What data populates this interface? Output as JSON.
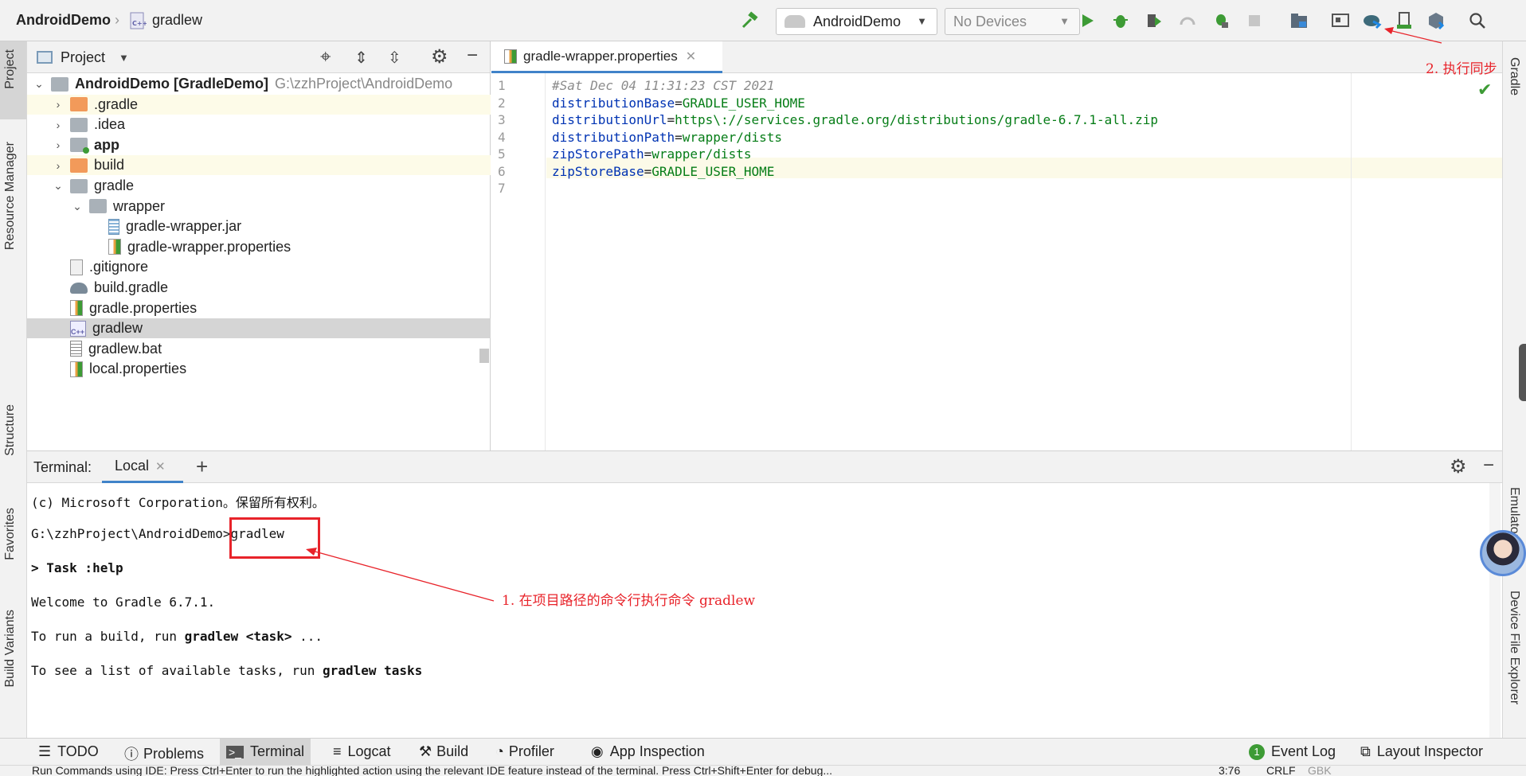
{
  "breadcrumb": {
    "project": "AndroidDemo",
    "file": "gradlew"
  },
  "toolbar": {
    "run_config": "AndroidDemo",
    "device": "No Devices"
  },
  "left_stripe": {
    "project": "Project",
    "resource_manager": "Resource Manager",
    "structure": "Structure",
    "favorites": "Favorites",
    "build_variants": "Build Variants"
  },
  "right_stripe": {
    "gradle": "Gradle",
    "emulator": "Emulator",
    "device_file_explorer": "Device File Explorer"
  },
  "project_panel": {
    "title": "Project",
    "tree": [
      {
        "label": "AndroidDemo [GradleDemo]",
        "path": "G:\\zzhProject\\AndroidDemo",
        "depth": 0,
        "expanded": true,
        "icon": "folder-gray"
      },
      {
        "label": ".gradle",
        "depth": 1,
        "expanded": false,
        "icon": "folder-orange"
      },
      {
        "label": ".idea",
        "depth": 1,
        "expanded": false,
        "icon": "folder-gray"
      },
      {
        "label": "app",
        "depth": 1,
        "expanded": false,
        "icon": "module"
      },
      {
        "label": "build",
        "depth": 1,
        "expanded": false,
        "icon": "folder-orange"
      },
      {
        "label": "gradle",
        "depth": 1,
        "expanded": true,
        "icon": "folder-gray"
      },
      {
        "label": "wrapper",
        "depth": 2,
        "expanded": true,
        "icon": "folder-gray"
      },
      {
        "label": "gradle-wrapper.jar",
        "depth": 3,
        "icon": "jar"
      },
      {
        "label": "gradle-wrapper.properties",
        "depth": 3,
        "icon": "properties"
      },
      {
        "label": ".gitignore",
        "depth": 1,
        "icon": "ignore"
      },
      {
        "label": "build.gradle",
        "depth": 1,
        "icon": "gradle"
      },
      {
        "label": "gradle.properties",
        "depth": 1,
        "icon": "properties"
      },
      {
        "label": "gradlew",
        "depth": 1,
        "icon": "cpp",
        "selected": true
      },
      {
        "label": "gradlew.bat",
        "depth": 1,
        "icon": "text"
      },
      {
        "label": "local.properties",
        "depth": 1,
        "icon": "properties"
      }
    ]
  },
  "editor": {
    "tab": "gradle-wrapper.properties",
    "lines": [
      {
        "n": "1",
        "comment": "#Sat Dec 04 11:31:23 CST 2021"
      },
      {
        "n": "2",
        "key": "distributionBase",
        "value": "GRADLE_USER_HOME"
      },
      {
        "n": "3",
        "key": "distributionUrl",
        "value": "https\\://services.gradle.org/distributions/gradle-6.7.1-all.zip"
      },
      {
        "n": "4",
        "key": "distributionPath",
        "value": "wrapper/dists"
      },
      {
        "n": "5",
        "key": "zipStorePath",
        "value": "wrapper/dists"
      },
      {
        "n": "6",
        "key": "zipStoreBase",
        "value": "GRADLE_USER_HOME"
      },
      {
        "n": "7"
      }
    ]
  },
  "terminal": {
    "label": "Terminal:",
    "tab": "Local",
    "line1": "(c) Microsoft Corporation。保留所有权利。",
    "prompt": "G:\\zzhProject\\AndroidDemo>",
    "command": "gradlew",
    "task_prefix": "> ",
    "task": "Task :help",
    "welcome": "Welcome to Gradle 6.7.1.",
    "run_build_a": "To run a build, run ",
    "run_build_b": "gradlew <task>",
    "run_build_c": " ...",
    "list_tasks_a": "To see a list of available tasks, run ",
    "list_tasks_b": "gradlew tasks"
  },
  "annotations": {
    "step1": "1. 在项目路径的命令行执行命令 gradlew",
    "step2": "2. 执行同步"
  },
  "bottom_tabs": {
    "todo": "TODO",
    "problems": "Problems",
    "terminal": "Terminal",
    "logcat": "Logcat",
    "build": "Build",
    "profiler": "Profiler",
    "app_inspection": "App Inspection",
    "event_log_count": "1",
    "event_log": "Event Log",
    "layout_inspector": "Layout Inspector"
  },
  "status_bar": {
    "message": "Run Commands using IDE: Press Ctrl+Enter to run the highlighted action using the relevant IDE feature instead of the terminal. Press Ctrl+Shift+Enter for debug...",
    "position": "3:76",
    "line_sep": "CRLF",
    "encoding": "GBK"
  },
  "colors": {
    "accent_green": "#3d9b35",
    "annotation_red": "#e8232a",
    "selection": "#d5d5d5",
    "highlight_row": "#fdfbe8"
  }
}
